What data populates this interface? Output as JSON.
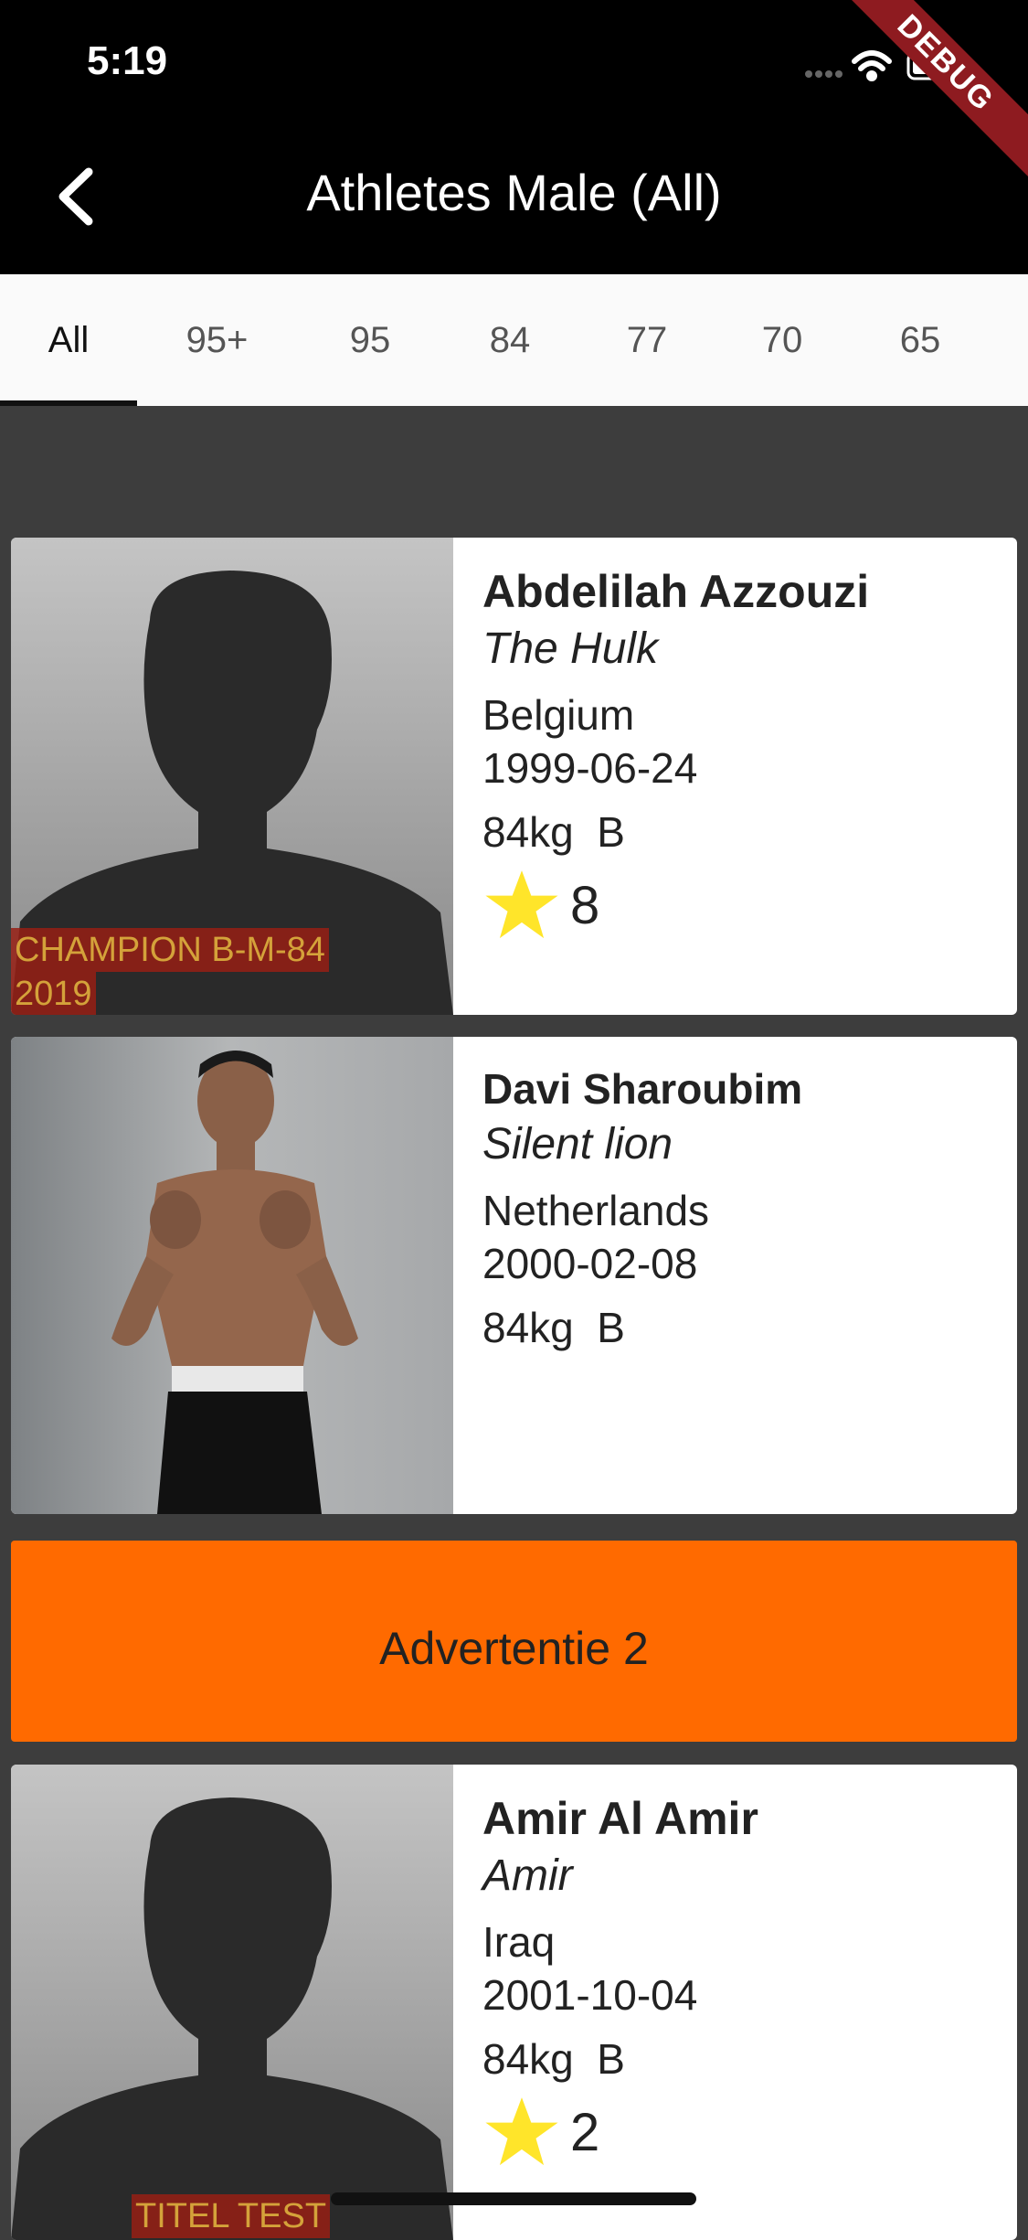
{
  "status_bar": {
    "time": "5:19"
  },
  "debug_banner": "DEBUG",
  "header": {
    "title": "Athletes Male (All)"
  },
  "tabs": [
    {
      "label": "All",
      "active": true
    },
    {
      "label": "95+"
    },
    {
      "label": "95"
    },
    {
      "label": "84"
    },
    {
      "label": "77"
    },
    {
      "label": "70"
    },
    {
      "label": "65"
    }
  ],
  "athletes": [
    {
      "name": "Abdelilah Azzouzi",
      "nickname": "The Hulk",
      "country": "Belgium",
      "birthdate": "1999-06-24",
      "weight_class": "84kg  B",
      "stars": "8",
      "title_line1": "CHAMPION B-M-84",
      "title_line2": "2019"
    },
    {
      "name": "Davi Sharoubim",
      "nickname": "Silent lion",
      "country": "Netherlands",
      "birthdate": "2000-02-08",
      "weight_class": "84kg  B"
    },
    {
      "name": "Amir Al Amir",
      "nickname": "Amir",
      "country": "Iraq",
      "birthdate": "2001-10-04",
      "weight_class": "84kg  B",
      "stars": "2",
      "title_line1": "TITEL TEST"
    }
  ],
  "ad": {
    "label": "Advertentie 2"
  },
  "colors": {
    "ad_background": "#ff6a00",
    "star": "#ffe52a",
    "badge_bg": "#961e14",
    "badge_text": "#d4a23a"
  }
}
